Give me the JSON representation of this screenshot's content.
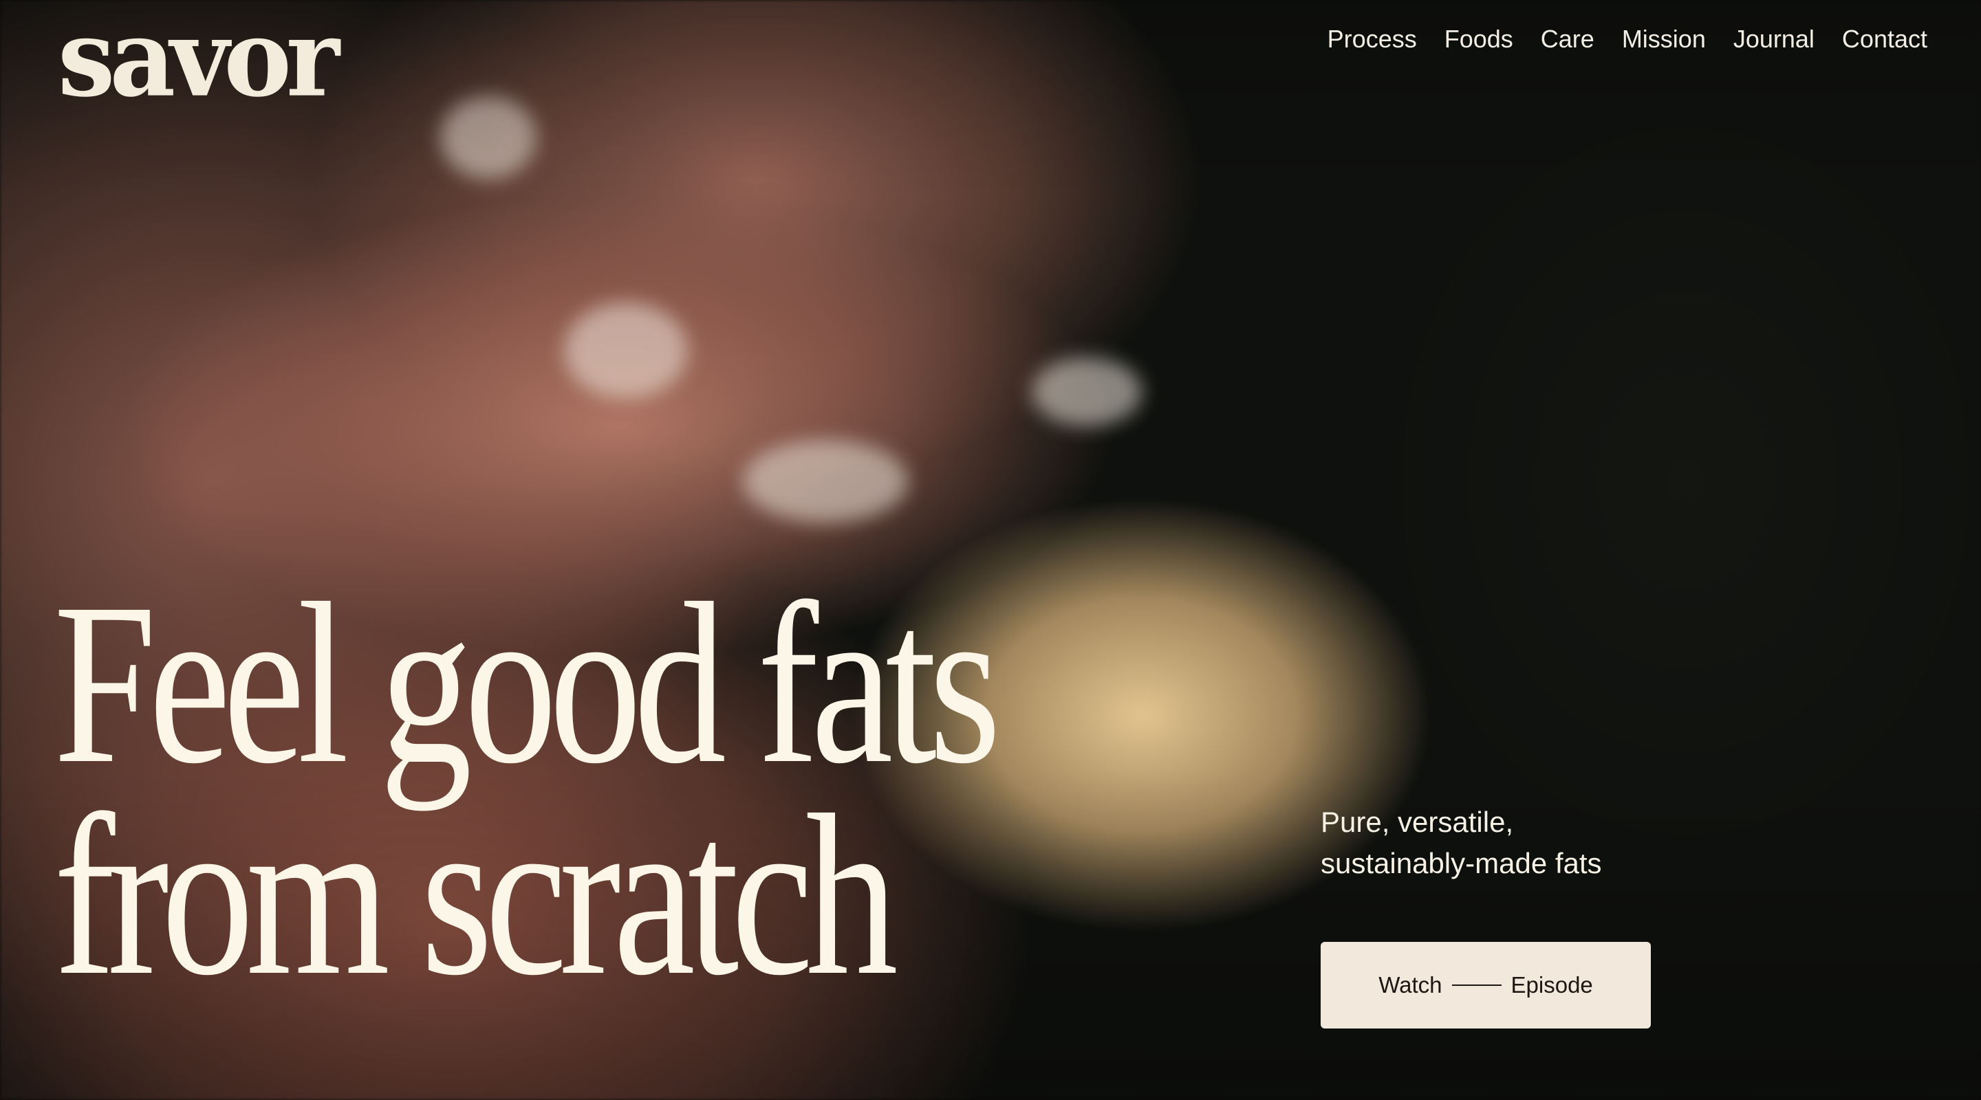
{
  "brand": {
    "logo_text": "savor"
  },
  "nav": {
    "items": [
      {
        "label": "Process"
      },
      {
        "label": "Foods"
      },
      {
        "label": "Care"
      },
      {
        "label": "Mission"
      },
      {
        "label": "Journal"
      },
      {
        "label": "Contact"
      }
    ]
  },
  "hero": {
    "headline_line1": "Feel good fats",
    "headline_line2": "from scratch",
    "tagline_line1": "Pure, versatile,",
    "tagline_line2": "sustainably-made fats",
    "cta": {
      "label_left": "Watch",
      "label_right": "Episode"
    }
  },
  "colors": {
    "headline": "#fcf6e8",
    "cta_background": "#f2e8dc",
    "cta_text": "#1e1612",
    "background_dark": "#0b0c0a"
  }
}
